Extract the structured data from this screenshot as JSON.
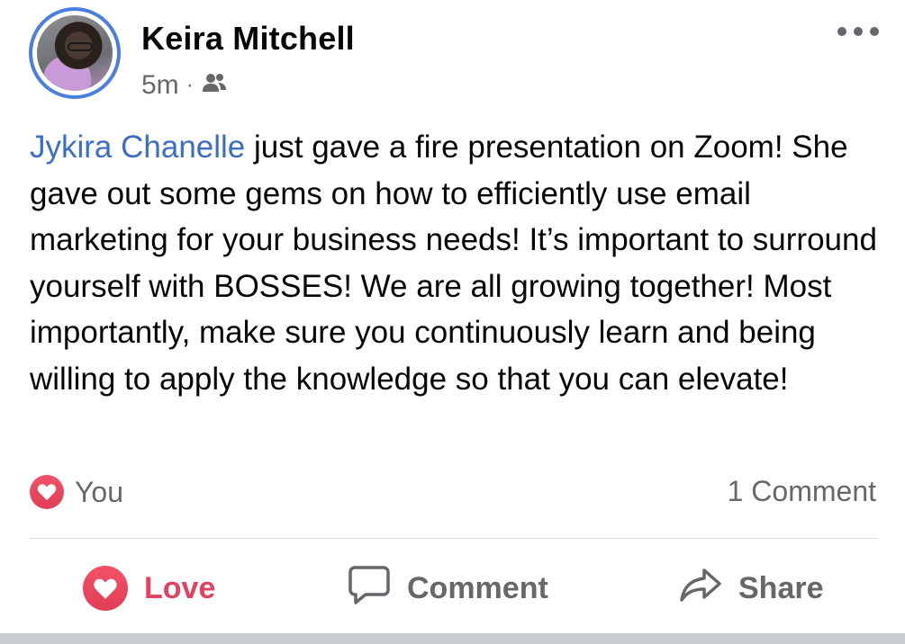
{
  "post": {
    "author": "Keira Mitchell",
    "timestamp": "5m",
    "separator": "·",
    "audience_icon": "friends-icon",
    "mention": "Jykira Chanelle",
    "text": " just gave a fire presentation on Zoom! She gave out some gems on how to efficiently use email marketing for your business needs! It’s important to surround yourself with BOSSES! We are all growing together! Most importantly, make sure you continuously learn and being willing to apply the knowledge so that you can elevate!"
  },
  "reactions": {
    "icon": "heart-icon",
    "label": "You",
    "comment_count": "1 Comment"
  },
  "actions": {
    "love_label": "Love",
    "comment_label": "Comment",
    "share_label": "Share"
  },
  "colors": {
    "accent_blue": "#3b6ec6",
    "love_red": "#e4405f",
    "muted_text": "#65676b",
    "avatar_ring": "#4a7ee0"
  }
}
